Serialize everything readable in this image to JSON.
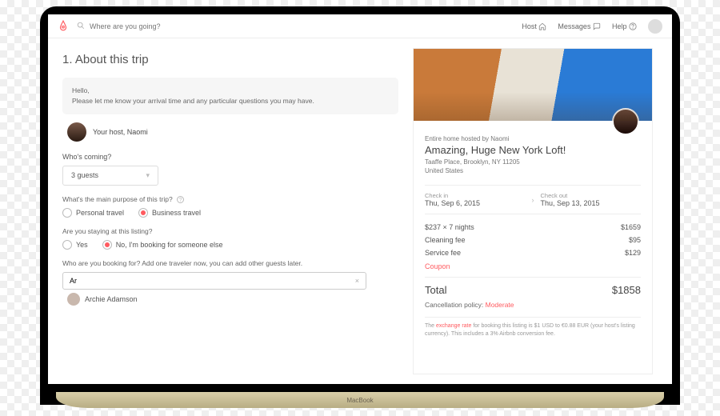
{
  "nav": {
    "search_placeholder": "Where are you going?",
    "host": "Host",
    "messages": "Messages",
    "help": "Help"
  },
  "step": {
    "heading": "1. About this trip",
    "host_message_greeting": "Hello,",
    "host_message_body": "Please let me know your arrival time and any particular questions you may have.",
    "host_caption": "Your host, Naomi",
    "whos_coming": "Who's coming?",
    "guests_value": "3 guests",
    "purpose_q": "What's the main purpose of this trip?",
    "purpose_personal": "Personal travel",
    "purpose_business": "Business travel",
    "staying_q": "Are you staying at this listing?",
    "staying_yes": "Yes",
    "staying_no": "No, I'm booking for someone else",
    "traveler_q": "Who are you booking for? Add one traveler now, you can add other guests later.",
    "traveler_input": "Ar",
    "traveler_suggestion": "Archie Adamson"
  },
  "card": {
    "hosted_by": "Entire home hosted by Naomi",
    "title": "Amazing, Huge New York Loft!",
    "address_line1": "Taaffe Place, Brooklyn, NY 11205",
    "address_line2": "United States",
    "checkin_lbl": "Check in",
    "checkin_val": "Thu, Sep 6, 2015",
    "checkout_lbl": "Check out",
    "checkout_val": "Thu, Sep 13, 2015",
    "rate_line": "$237 × 7 nights",
    "rate_amount": "$1659",
    "cleaning_lbl": "Cleaning fee",
    "cleaning_amount": "$95",
    "service_lbl": "Service fee",
    "service_amount": "$129",
    "coupon": "Coupon",
    "total_lbl": "Total",
    "total_amount": "$1858",
    "policy_lbl": "Cancellation policy: ",
    "policy_val": "Moderate",
    "fine_print_a": "The ",
    "fine_print_link": "exchange rate",
    "fine_print_b": " for booking this listing is $1 USD to €0.88 EUR (your host's listing currency). This includes a 3% Airbnb conversion fee."
  },
  "chrome": {
    "macbook": "MacBook"
  }
}
